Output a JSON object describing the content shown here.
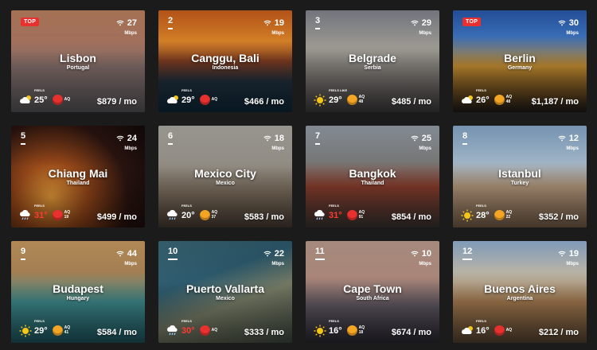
{
  "cities": [
    {
      "rank": "",
      "top": "TOP",
      "speed": "27",
      "unit": "Mbps",
      "name": "Lisbon",
      "country": "Portugal",
      "feels": "FEELS",
      "temp": "25°",
      "aq_label": "AQ",
      "aq": "",
      "price": "$879 / mo",
      "weather": "cloud-sun-icon",
      "hot": false,
      "bg": "linear-gradient(180deg,#c98a66 0%,#b07a64 30%,#7f6a66 55%,#5c5a5e 100%)"
    },
    {
      "rank": "2",
      "top": "",
      "speed": "19",
      "unit": "Mbps",
      "name": "Canggu, Bali",
      "country": "Indonesia",
      "feels": "FEELS",
      "temp": "29°",
      "aq_label": "AQ",
      "aq": "",
      "price": "$466 / mo",
      "weather": "cloud-sun-icon",
      "hot": false,
      "bg": "linear-gradient(180deg,#d9641e 0%,#e58a2a 30%,#7a3a20 50%,#1f2d3a 70%,#0f2a3c 100%)"
    },
    {
      "rank": "3",
      "top": "",
      "speed": "29",
      "unit": "Mbps",
      "name": "Belgrade",
      "country": "Serbia",
      "feels": "FEELS LIKE",
      "temp": "29°",
      "aq_label": "AQ",
      "aq": "48",
      "price": "$485 / mo",
      "weather": "sun-icon",
      "hot": false,
      "bg": "linear-gradient(180deg,#8a8f98 0%,#a6a39c 35%,#6e6a66 70%,#3f3d3d 100%)"
    },
    {
      "rank": "",
      "top": "TOP",
      "speed": "30",
      "unit": "Mbps",
      "name": "Berlin",
      "country": "Germany",
      "feels": "FEELS",
      "temp": "26°",
      "aq_label": "AQ",
      "aq": "48",
      "price": "$1,187 / mo",
      "weather": "cloud-sun-icon",
      "hot": false,
      "bg": "linear-gradient(180deg,#2a5fb8 0%,#3e78c9 25%,#c08a2f 55%,#6a4a1e 80%,#1d1a1a 100%)"
    },
    {
      "rank": "5",
      "top": "",
      "speed": "24",
      "unit": "Mbps",
      "name": "Chiang Mai",
      "country": "Thailand",
      "feels": "FEELS",
      "temp": "31°",
      "aq_label": "AQ",
      "aq": "19",
      "price": "$499 / mo",
      "weather": "cloud-rain-icon",
      "hot": true,
      "bg": "radial-gradient(circle at 30% 70%,#f0a23c 0%,#9c4a1a 30%,#2b1410 65%,#120a08 100%)"
    },
    {
      "rank": "6",
      "top": "",
      "speed": "18",
      "unit": "Mbps",
      "name": "Mexico City",
      "country": "Mexico",
      "feels": "FEELS",
      "temp": "20°",
      "aq_label": "AQ",
      "aq": "37",
      "price": "$583 / mo",
      "weather": "cloud-rain-icon",
      "hot": false,
      "bg": "linear-gradient(180deg,#b7b4ad 0%,#9c978e 35%,#7d6e5e 65%,#4b3f36 100%)"
    },
    {
      "rank": "7",
      "top": "",
      "speed": "25",
      "unit": "Mbps",
      "name": "Bangkok",
      "country": "Thailand",
      "feels": "FEELS",
      "temp": "31°",
      "aq_label": "AQ",
      "aq": "91",
      "price": "$854 / mo",
      "weather": "cloud-rain-icon",
      "hot": true,
      "bg": "linear-gradient(180deg,#9ea7b1 0%,#7e7f7e 35%,#8a3d2c 60%,#3b3633 100%)"
    },
    {
      "rank": "8",
      "top": "",
      "speed": "12",
      "unit": "Mbps",
      "name": "Istanbul",
      "country": "Turkey",
      "feels": "FEELS",
      "temp": "28°",
      "aq_label": "AQ",
      "aq": "22",
      "price": "$352 / mo",
      "weather": "sun-icon",
      "hot": false,
      "bg": "linear-gradient(180deg,#8fb3d6 0%,#a9c0d3 35%,#b79a7d 60%,#7a624c 100%)"
    },
    {
      "rank": "9",
      "top": "",
      "speed": "44",
      "unit": "Mbps",
      "name": "Budapest",
      "country": "Hungary",
      "feels": "FEELS",
      "temp": "29°",
      "aq_label": "AQ",
      "aq": "41",
      "price": "$584 / mo",
      "weather": "sun-icon",
      "hot": false,
      "bg": "linear-gradient(180deg,#d6a567 0%,#b28a5a 30%,#3f8a8c 60%,#1f5a63 100%)"
    },
    {
      "rank": "10",
      "top": "",
      "speed": "22",
      "unit": "Mbps",
      "name": "Puerto Vallarta",
      "country": "Mexico",
      "feels": "FEELS",
      "temp": "30°",
      "aq_label": "AQ",
      "aq": "",
      "price": "$333 / mo",
      "weather": "cloud-rain-icon",
      "hot": true,
      "bg": "linear-gradient(160deg,#3f6f7f 0%,#2f5f73 35%,#7a7f68 60%,#3e4a40 100%)"
    },
    {
      "rank": "11",
      "top": "",
      "speed": "10",
      "unit": "Mbps",
      "name": "Cape Town",
      "country": "South Africa",
      "feels": "FEELS",
      "temp": "16°",
      "aq_label": "AQ",
      "aq": "18",
      "price": "$674 / mo",
      "weather": "sun-icon",
      "hot": false,
      "bg": "linear-gradient(180deg,#c9a898 0%,#b48e80 35%,#5c5560 65%,#2b2a33 100%)"
    },
    {
      "rank": "12",
      "top": "",
      "speed": "19",
      "unit": "Mbps",
      "name": "Buenos Aires",
      "country": "Argentina",
      "feels": "FEELS",
      "temp": "16°",
      "aq_label": "AQ",
      "aq": "",
      "price": "$212 / mo",
      "weather": "cloud-sun-icon",
      "hot": false,
      "bg": "linear-gradient(180deg,#9cbce0 0%,#c7c3b6 30%,#a37a4e 60%,#5a4633 100%)"
    }
  ]
}
